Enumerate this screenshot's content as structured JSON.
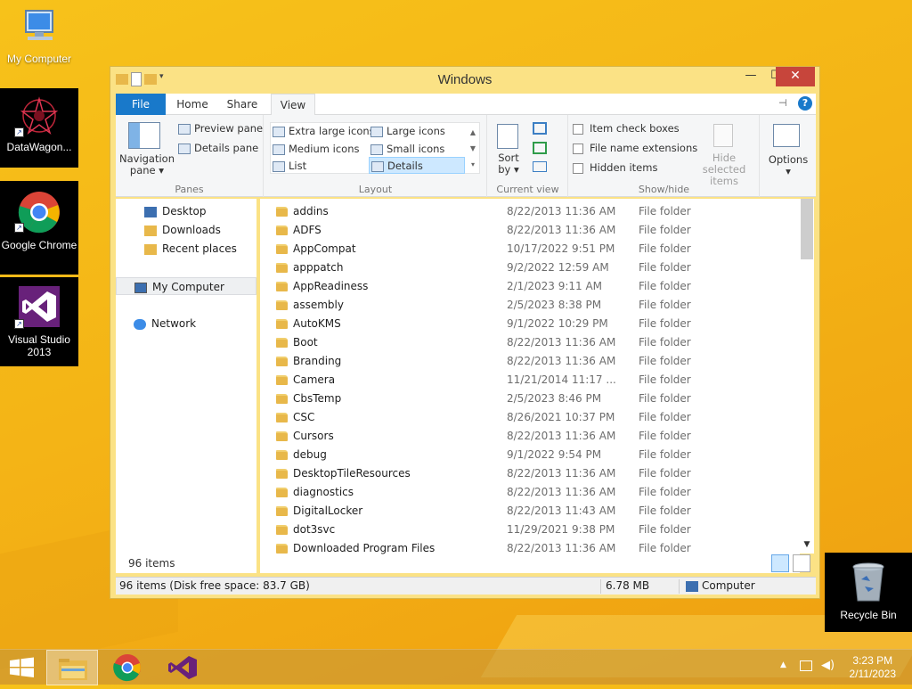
{
  "desktop": {
    "icons": [
      {
        "label": "My Computer"
      },
      {
        "label": "DataWagon..."
      },
      {
        "label": "Google Chrome"
      },
      {
        "label": "Visual Studio 2013"
      },
      {
        "label": "Recycle Bin"
      }
    ]
  },
  "window": {
    "title": "Windows",
    "minimize": "—",
    "maximize": "☐",
    "close": "✕",
    "tabs": [
      "File",
      "Home",
      "Share",
      "View"
    ],
    "active_tab": "View",
    "ribbon": {
      "panes": {
        "label": "Panes",
        "navigation_pane": "Navigation pane",
        "preview_pane": "Preview pane",
        "details_pane": "Details pane"
      },
      "layout": {
        "label": "Layout",
        "items": [
          "Extra large icons",
          "Large icons",
          "Medium icons",
          "Small icons",
          "List",
          "Details"
        ],
        "selected": "Details"
      },
      "current_view": {
        "label": "Current view",
        "sort_by": "Sort by"
      },
      "show_hide": {
        "label": "Show/hide",
        "item_check_boxes": "Item check boxes",
        "file_name_extensions": "File name extensions",
        "hidden_items": "Hidden items",
        "hide_selected_items": "Hide selected items"
      },
      "options": "Options"
    },
    "nav": {
      "items": [
        {
          "label": "Desktop",
          "icon": "desktop-icon"
        },
        {
          "label": "Downloads",
          "icon": "downloads-icon"
        },
        {
          "label": "Recent places",
          "icon": "recent-places-icon"
        },
        {
          "label": "My Computer",
          "icon": "computer-icon"
        },
        {
          "label": "Network",
          "icon": "network-icon"
        }
      ],
      "selected": "My Computer"
    },
    "files": [
      {
        "name": "addins",
        "date": "8/22/2013 11:36 AM",
        "type": "File folder"
      },
      {
        "name": "ADFS",
        "date": "8/22/2013 11:36 AM",
        "type": "File folder"
      },
      {
        "name": "AppCompat",
        "date": "10/17/2022 9:51 PM",
        "type": "File folder"
      },
      {
        "name": "apppatch",
        "date": "9/2/2022 12:59 AM",
        "type": "File folder"
      },
      {
        "name": "AppReadiness",
        "date": "2/1/2023 9:11 AM",
        "type": "File folder"
      },
      {
        "name": "assembly",
        "date": "2/5/2023 8:38 PM",
        "type": "File folder"
      },
      {
        "name": "AutoKMS",
        "date": "9/1/2022 10:29 PM",
        "type": "File folder"
      },
      {
        "name": "Boot",
        "date": "8/22/2013 11:36 AM",
        "type": "File folder"
      },
      {
        "name": "Branding",
        "date": "8/22/2013 11:36 AM",
        "type": "File folder"
      },
      {
        "name": "Camera",
        "date": "11/21/2014 11:17 ...",
        "type": "File folder"
      },
      {
        "name": "CbsTemp",
        "date": "2/5/2023 8:46 PM",
        "type": "File folder"
      },
      {
        "name": "CSC",
        "date": "8/26/2021 10:37 PM",
        "type": "File folder"
      },
      {
        "name": "Cursors",
        "date": "8/22/2013 11:36 AM",
        "type": "File folder"
      },
      {
        "name": "debug",
        "date": "9/1/2022 9:54 PM",
        "type": "File folder"
      },
      {
        "name": "DesktopTileResources",
        "date": "8/22/2013 11:36 AM",
        "type": "File folder"
      },
      {
        "name": "diagnostics",
        "date": "8/22/2013 11:36 AM",
        "type": "File folder"
      },
      {
        "name": "DigitalLocker",
        "date": "8/22/2013 11:43 AM",
        "type": "File folder"
      },
      {
        "name": "dot3svc",
        "date": "11/29/2021 9:38 PM",
        "type": "File folder"
      },
      {
        "name": "Downloaded Program Files",
        "date": "8/22/2013 11:36 AM",
        "type": "File folder"
      }
    ],
    "items_count": "96 items",
    "status": {
      "left": "96 items (Disk free space: 83.7 GB)",
      "size": "6.78 MB",
      "location": "Computer"
    }
  },
  "taskbar": {
    "time": "3:23 PM",
    "date": "2/11/2023",
    "tray_arrow": "▲"
  },
  "colors": {
    "accent": "#1979ca",
    "close": "#c7453b",
    "desktop": "#f4b416"
  }
}
